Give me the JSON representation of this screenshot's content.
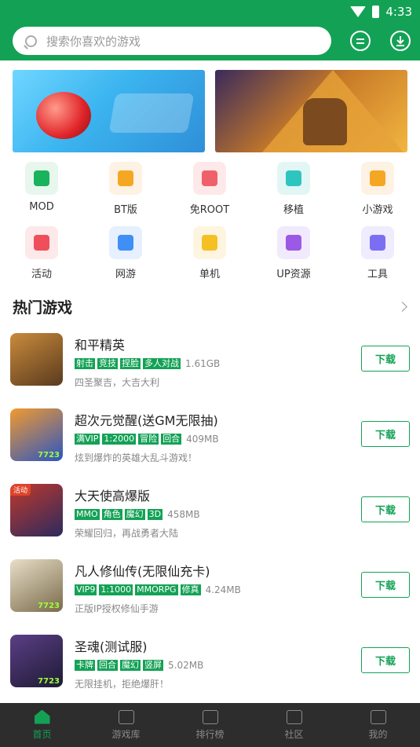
{
  "status": {
    "time": "4:33"
  },
  "search": {
    "placeholder": "搜索你喜欢的游戏"
  },
  "banners": [
    {
      "name": "banner-fruit-game"
    },
    {
      "name": "banner-block-world"
    }
  ],
  "categories": [
    {
      "label": "MOD",
      "icon": "lock-icon",
      "color": "#19b35c",
      "bg": "#e8f7ee"
    },
    {
      "label": "BT版",
      "icon": "hourglass-icon",
      "color": "#f5a623",
      "bg": "#fdf2e3"
    },
    {
      "label": "免ROOT",
      "icon": "shield-icon",
      "color": "#f0606a",
      "bg": "#fde9ea"
    },
    {
      "label": "移植",
      "icon": "joystick-icon",
      "color": "#2ec5c0",
      "bg": "#e2f6f5"
    },
    {
      "label": "小游戏",
      "icon": "pacman-icon",
      "color": "#f5a623",
      "bg": "#fdf2e3"
    },
    {
      "label": "活动",
      "icon": "star-icon",
      "color": "#ef4f5a",
      "bg": "#fde9ea"
    },
    {
      "label": "网游",
      "icon": "network-icon",
      "color": "#3f8ff5",
      "bg": "#e6f0fe"
    },
    {
      "label": "单机",
      "icon": "gamepad-icon",
      "color": "#f5c024",
      "bg": "#fdf5e0"
    },
    {
      "label": "UP资源",
      "icon": "share-icon",
      "color": "#9b59e6",
      "bg": "#f1e9fc"
    },
    {
      "label": "工具",
      "icon": "toolbox-icon",
      "color": "#7b6ef2",
      "bg": "#eeecfd"
    }
  ],
  "section": {
    "title": "热门游戏"
  },
  "games": [
    {
      "name": "和平精英",
      "tags": [
        "射击",
        "竞技",
        "捏脸",
        "多人对战"
      ],
      "size": "1.61GB",
      "desc": "四圣聚吉，大吉大利",
      "badge": "",
      "num": "",
      "thumb": "#c98b3c",
      "thumb2": "#5a3a1e"
    },
    {
      "name": "超次元觉醒(送GM无限抽)",
      "tags": [
        "满VIP",
        "1:2000",
        "冒险",
        "回合"
      ],
      "size": "409MB",
      "desc": "炫到爆炸的英雄大乱斗游戏！",
      "badge": "",
      "num": "7723",
      "thumb": "#f29a2e",
      "thumb2": "#2a55c4"
    },
    {
      "name": "大天使高爆版",
      "tags": [
        "MMO",
        "角色",
        "魔幻",
        "3D"
      ],
      "size": "458MB",
      "desc": "荣耀回归，再战勇者大陆",
      "badge": "活动",
      "num": "",
      "thumb": "#c0392b",
      "thumb2": "#2c2a5e"
    },
    {
      "name": "凡人修仙传(无限仙充卡)",
      "tags": [
        "VIP9",
        "1:1000",
        "MMORPG",
        "修真"
      ],
      "size": "4.24MB",
      "desc": "正版IP授权修仙手游",
      "badge": "",
      "num": "7723",
      "thumb": "#e8dfc8",
      "thumb2": "#7a6a4a"
    },
    {
      "name": "圣魂(测试服)",
      "tags": [
        "卡牌",
        "回合",
        "魔幻",
        "竖屏"
      ],
      "size": "5.02MB",
      "desc": "无限挂机，拒绝爆肝！",
      "badge": "",
      "num": "7723",
      "thumb": "#5b3f86",
      "thumb2": "#1e1a33"
    }
  ],
  "download_label": "下载",
  "tabs": [
    {
      "label": "首页",
      "active": true
    },
    {
      "label": "游戏库",
      "active": false
    },
    {
      "label": "排行榜",
      "active": false
    },
    {
      "label": "社区",
      "active": false
    },
    {
      "label": "我的",
      "active": false
    }
  ]
}
